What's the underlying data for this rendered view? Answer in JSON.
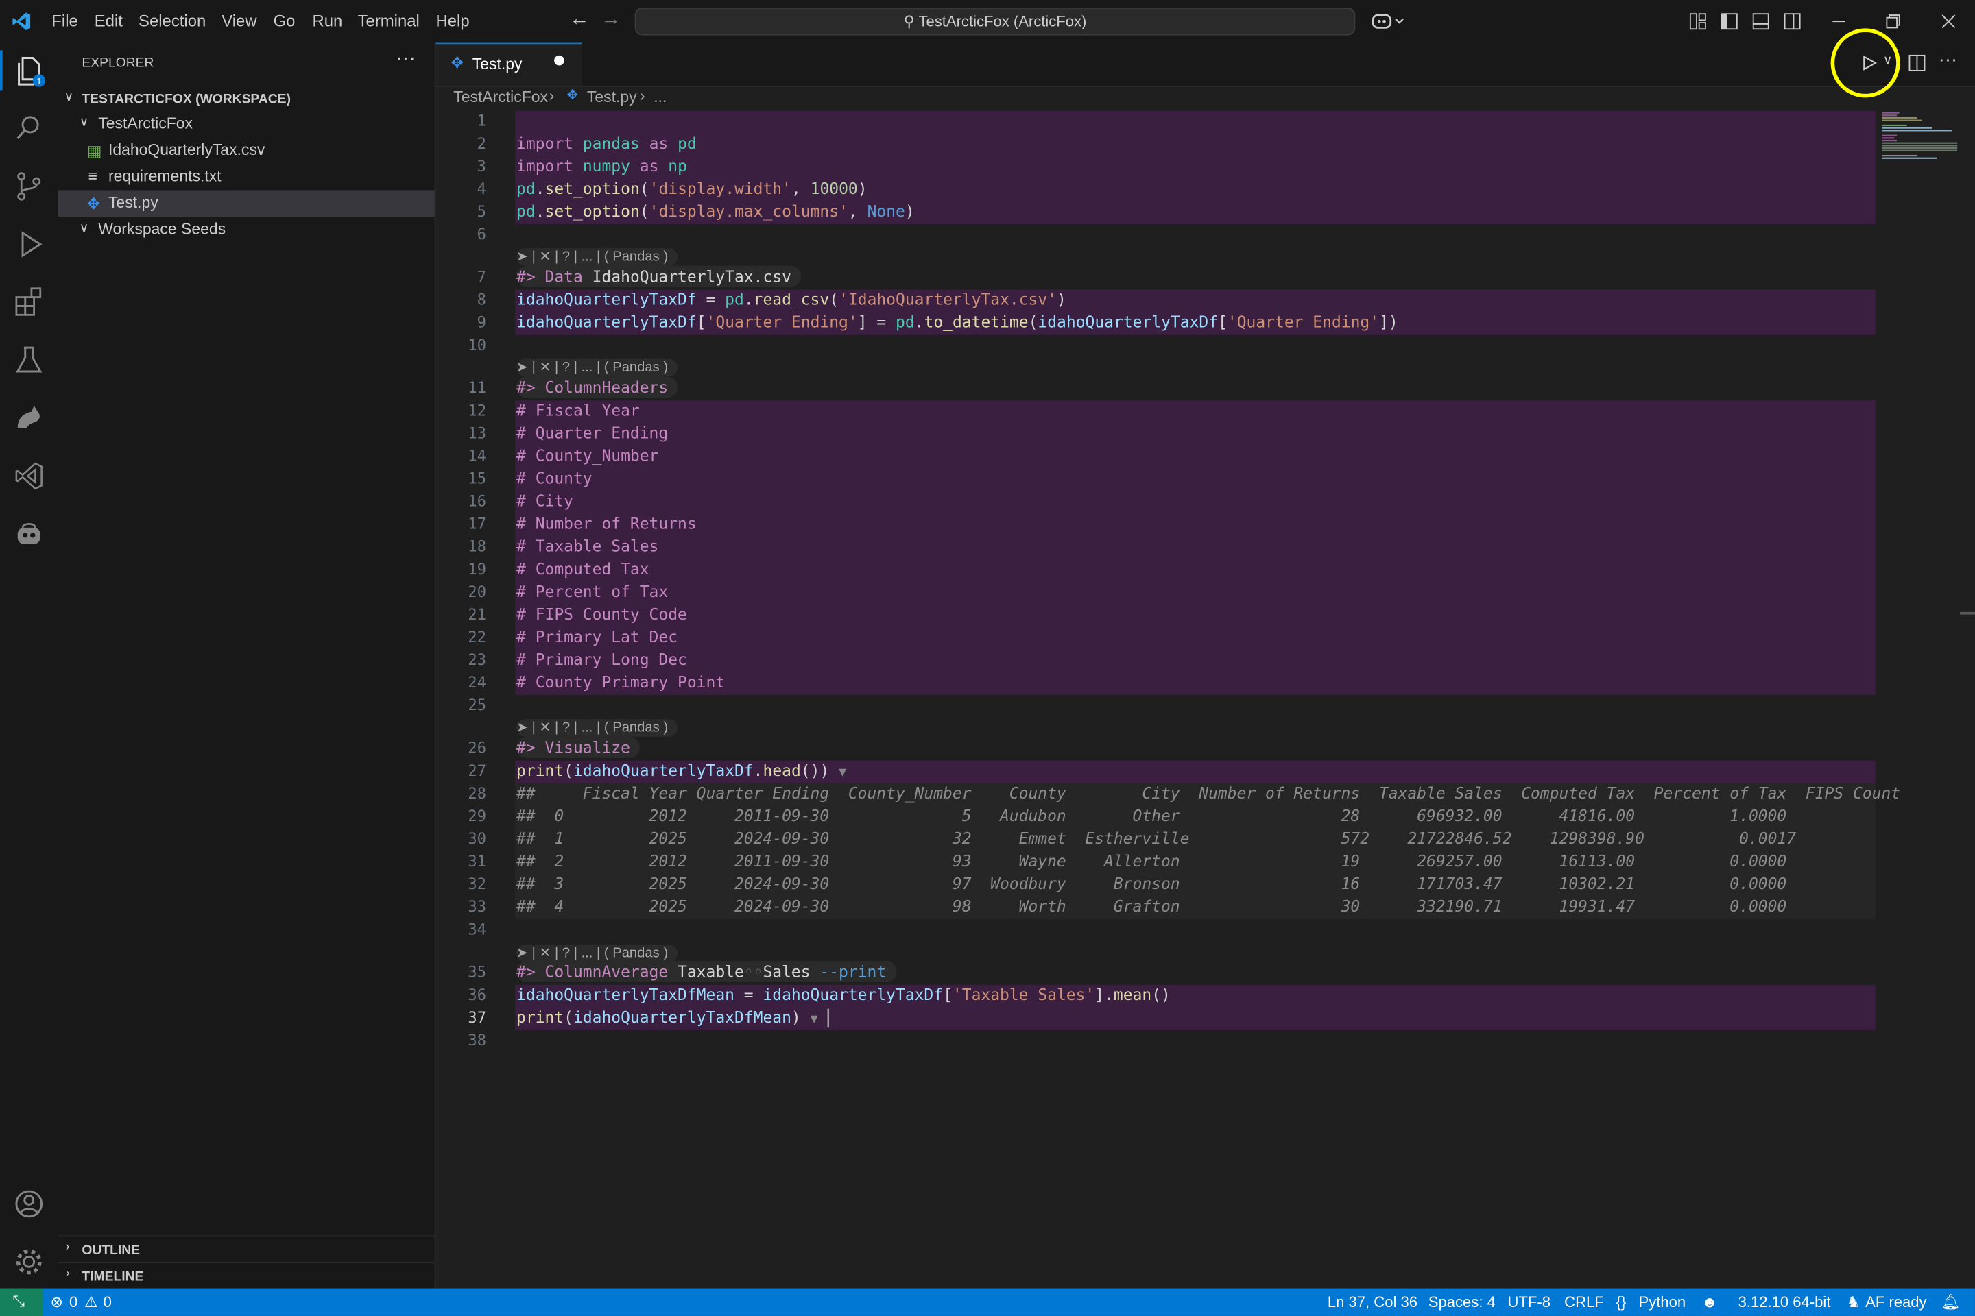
{
  "menu": [
    "File",
    "Edit",
    "Selection",
    "View",
    "Go",
    "Run",
    "Terminal",
    "Help"
  ],
  "search": {
    "text": "TestArcticFox (ArcticFox)"
  },
  "explorer": {
    "title": "EXPLORER",
    "workspace": "TESTARCTICFOX (WORKSPACE)",
    "folder": "TestArcticFox",
    "files": [
      "IdahoQuarterlyTax.csv",
      "requirements.txt",
      "Test.py"
    ],
    "seeds": "Workspace Seeds",
    "outline": "OUTLINE",
    "timeline": "TIMELINE",
    "badge": "1"
  },
  "tab": {
    "label": "Test.py"
  },
  "breadcrumb": {
    "folder": "TestArcticFox",
    "file": "Test.py",
    "more": "..."
  },
  "codelens": "➤ | ✕ | ? | ... | ( Pandas )",
  "lines": [
    "1",
    "2",
    "3",
    "4",
    "5",
    "6",
    "7",
    "8",
    "9",
    "10",
    "11",
    "12",
    "13",
    "14",
    "15",
    "16",
    "17",
    "18",
    "19",
    "20",
    "21",
    "22",
    "23",
    "24",
    "25",
    "26",
    "27",
    "28",
    "29",
    "30",
    "31",
    "32",
    "33",
    "34",
    "35",
    "36",
    "37",
    "38"
  ],
  "code": {
    "l2": "import pandas as pd",
    "l3": "import numpy as np",
    "l4": "pd.set_option('display.width', 10000)",
    "l5": "pd.set_option('display.max_columns', None)",
    "l7": "#> Data IdahoQuarterlyTax.csv",
    "l8": "idahoQuarterlyTaxDf = pd.read_csv('IdahoQuarterlyTax.csv')",
    "l9": "idahoQuarterlyTaxDf['Quarter Ending'] = pd.to_datetime(idahoQuarterlyTaxDf['Quarter Ending'])",
    "l11": "#> ColumnHeaders",
    "l12": "# Fiscal Year",
    "l13": "# Quarter Ending",
    "l14": "# County_Number",
    "l15": "# County",
    "l16": "# City",
    "l17": "# Number of Returns",
    "l18": "# Taxable Sales",
    "l19": "# Computed Tax",
    "l20": "# Percent of Tax",
    "l21": "# FIPS County Code",
    "l22": "# Primary Lat Dec",
    "l23": "# Primary Long Dec",
    "l24": "# County Primary Point",
    "l26": "#> Visualize",
    "l27": "print(idahoQuarterlyTaxDf.head())",
    "l28": "##     Fiscal Year Quarter Ending  County_Number    County        City  Number of Returns  Taxable Sales  Computed Tax  Percent of Tax  FIPS Count",
    "l29": "##  0         2012     2011-09-30              5   Audubon       Other                 28      696932.00      41816.00          1.0000",
    "l30": "##  1         2025     2024-09-30             32     Emmet  Estherville                572    21722846.52    1298398.90          0.0017",
    "l31": "##  2         2012     2011-09-30             93     Wayne    Allerton                 19      269257.00      16113.00          0.0000",
    "l32": "##  3         2025     2024-09-30             97  Woodbury     Bronson                 16      171703.47      10302.21          0.0000",
    "l33": "##  4         2025     2024-09-30             98     Worth     Grafton                 30      332190.71      19931.47          0.0000",
    "l35": "#> ColumnAverage Taxable◦◦Sales --print",
    "l36": "idahoQuarterlyTaxDfMean = idahoQuarterlyTaxDf['Taxable Sales'].mean()",
    "l37": "print(idahoQuarterlyTaxDfMean)"
  },
  "status": {
    "errors": "0",
    "warnings": "0",
    "position": "Ln 37, Col 36",
    "spaces": "Spaces: 4",
    "encoding": "UTF-8",
    "eol": "CRLF",
    "language": "Python",
    "interpreter": "3.12.10 64-bit",
    "af": "AF ready"
  },
  "colors": {
    "accent": "#0078d4",
    "highlight": "#3a1f40",
    "annotation": "#ffff00"
  }
}
